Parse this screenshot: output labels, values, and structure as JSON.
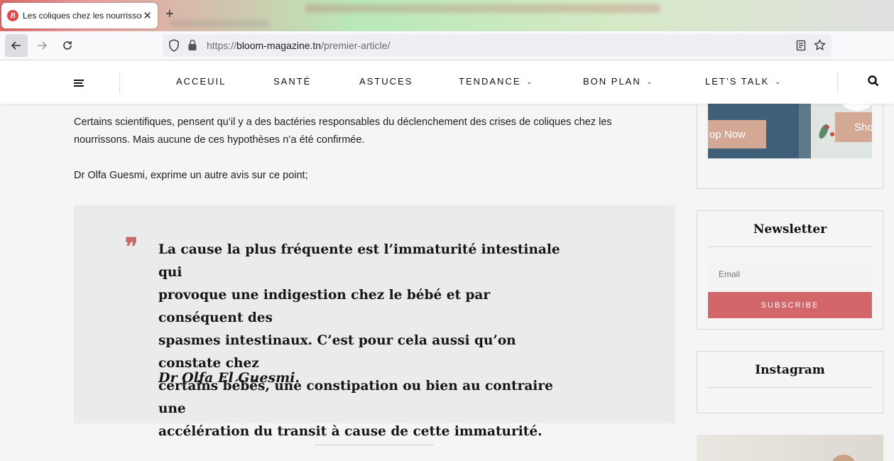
{
  "browser": {
    "tab_title": "Les coliques chez les nourrisson",
    "url_scheme": "https://",
    "url_host": "bloom-magazine.tn",
    "url_path": "/premier-article/"
  },
  "header": {
    "nav": [
      {
        "label": "ACCEUIL",
        "dropdown": false
      },
      {
        "label": "SANTÉ",
        "dropdown": false
      },
      {
        "label": "ASTUCES",
        "dropdown": false
      },
      {
        "label": "TENDANCE",
        "dropdown": true
      },
      {
        "label": "BON PLAN",
        "dropdown": true
      },
      {
        "label": "LET’S TALK",
        "dropdown": true
      }
    ]
  },
  "article": {
    "paragraph1_line1": "Certains scientifiques, pensent qu’il y a des bactéries responsables du déclenchement des crises de coliques chez les",
    "paragraph1_line2": "nourrissons. Mais aucune de ces hypothèses n’a été confirmée.",
    "paragraph2": "Dr Olfa Guesmi, exprime un autre avis sur ce point;",
    "quote_mark": "❞",
    "quote_lines": [
      "La cause la plus fréquente est l’immaturité intestinale qui",
      "provoque une indigestion chez le bébé et par conséquent des",
      "spasmes intestinaux.  C’est pour cela aussi qu’on constate chez",
      "certains bébés, une constipation ou bien au contraire une",
      "accélération du transit à cause de cette immaturité."
    ],
    "quote_author": "Dr Olfa El Guesmi."
  },
  "sidebar": {
    "ad_button_left": "op Now",
    "ad_button_right": "Sho",
    "newsletter_title": "Newsletter",
    "email_placeholder": "Email",
    "subscribe_label": "SUBSCRIBE",
    "instagram_title": "Instagram"
  },
  "colors": {
    "accent": "#d2666a",
    "quote_bg": "#ebebeb",
    "page_bg": "#f5f5f5"
  }
}
